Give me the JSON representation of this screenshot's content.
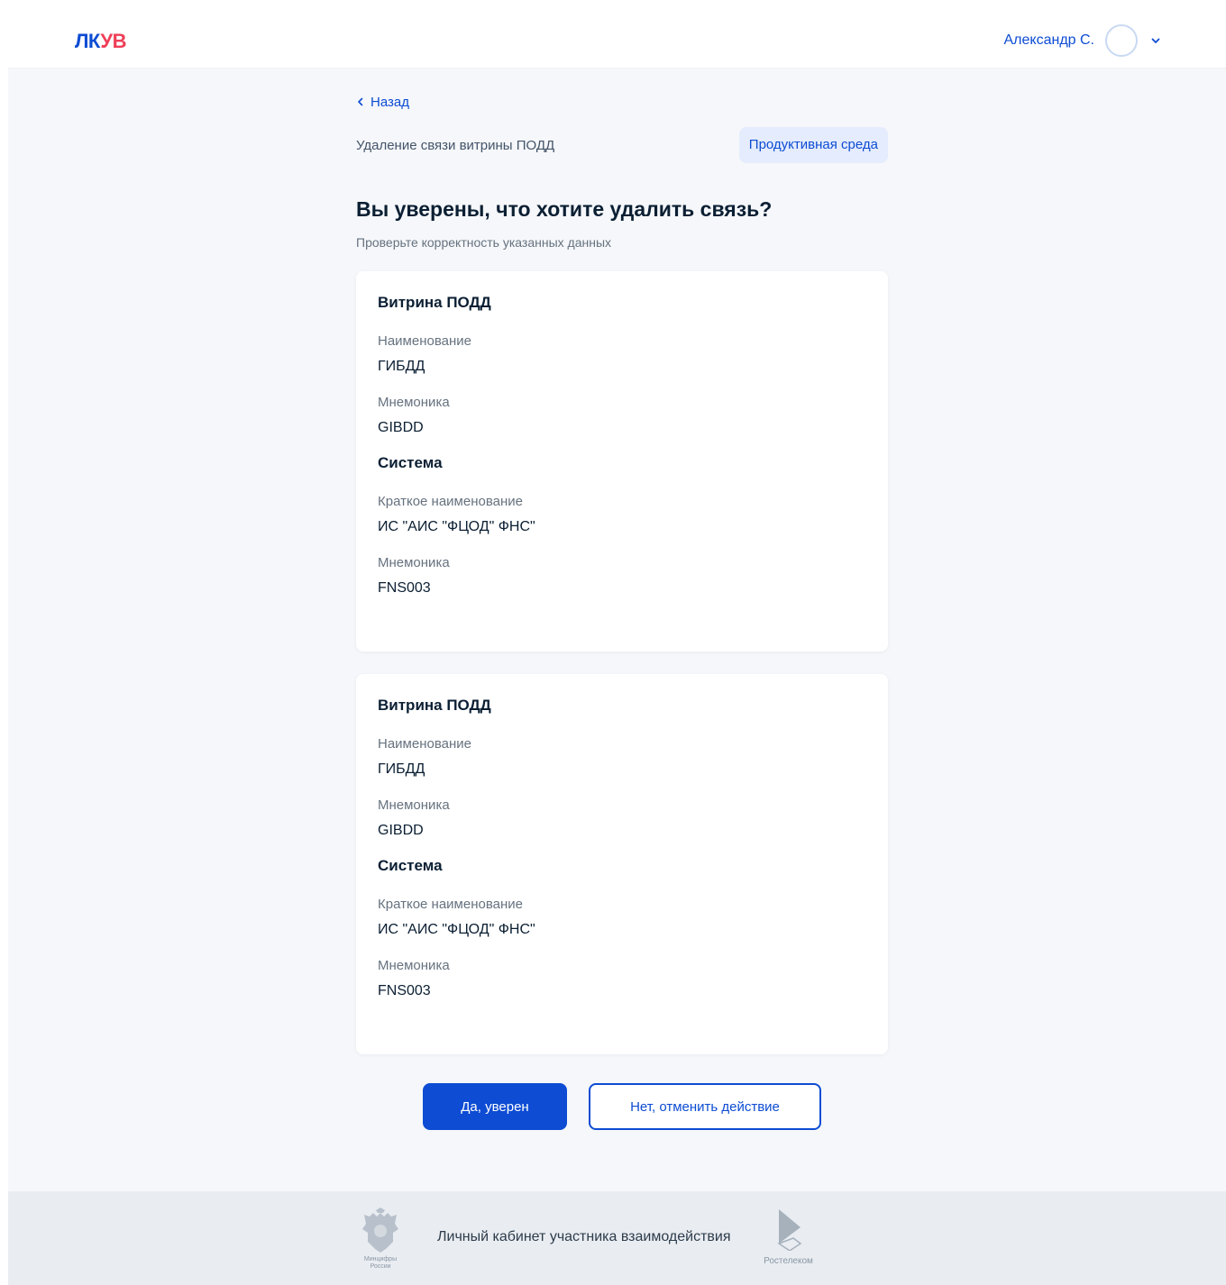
{
  "header": {
    "logo_lk": "ЛК",
    "logo_uv": "УВ",
    "user_name": "Александр С."
  },
  "main": {
    "back_label": "Назад",
    "service_title": "Удаление связи витрины ПОДД",
    "env_badge": "Продуктивная среда",
    "heading": "Вы уверены, что хотите удалить связь?",
    "subtitle": "Проверьте корректность указанных данных"
  },
  "cards": [
    {
      "showcase_title": "Витрина ПОДД",
      "name_label": "Наименование",
      "name_value": "ГИБДД",
      "mnemonic_label": "Мнемоника",
      "mnemonic_value": "GIBDD",
      "system_title": "Система",
      "short_name_label": "Краткое наименование",
      "short_name_value": "ИС \"АИС \"ФЦОД\" ФНС\"",
      "sys_mnemonic_label": "Мнемоника",
      "sys_mnemonic_value": "FNS003"
    },
    {
      "showcase_title": "Витрина ПОДД",
      "name_label": "Наименование",
      "name_value": "ГИБДД",
      "mnemonic_label": "Мнемоника",
      "mnemonic_value": "GIBDD",
      "system_title": "Система",
      "short_name_label": "Краткое наименование",
      "short_name_value": "ИС \"АИС \"ФЦОД\" ФНС\"",
      "sys_mnemonic_label": "Мнемоника",
      "sys_mnemonic_value": "FNS003"
    }
  ],
  "actions": {
    "confirm_label": "Да, уверен",
    "cancel_label": "Нет, отменить действие"
  },
  "footer": {
    "ministry_text_1": "Минцифры",
    "ministry_text_2": "России",
    "title": "Личный кабинет участника взаимодействия",
    "partner": "Ростелеком"
  },
  "colors": {
    "accent": "#0d4cd3",
    "logo_red": "#ee3f58",
    "background": "#f5f7fa",
    "badge_bg": "#e4ecfd"
  }
}
